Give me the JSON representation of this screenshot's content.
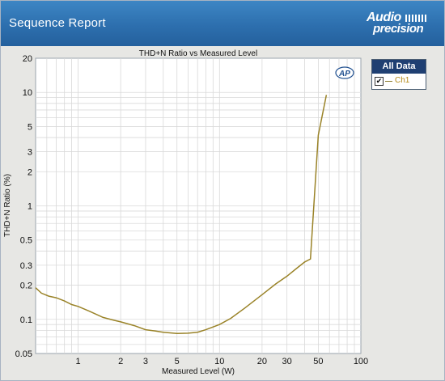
{
  "window": {
    "title": "Sequence Report",
    "brand_line1": "Audio",
    "brand_line2": "precision"
  },
  "legend": {
    "title": "All Data",
    "series_label": "Ch1",
    "checked": true
  },
  "ap_logo": "AP",
  "colors": {
    "header_bg": "#2d6fae",
    "series": "#9a8328",
    "grid": "#d9d9d9"
  },
  "chart_data": {
    "type": "line",
    "title": "THD+N Ratio vs Measured Level",
    "xlabel": "Measured Level (W)",
    "ylabel": "THD+N Ratio (%)",
    "xscale": "log",
    "yscale": "log",
    "xlim": [
      0.5,
      100
    ],
    "ylim": [
      0.05,
      20
    ],
    "xticks": [
      1,
      2,
      3,
      5,
      10,
      20,
      30,
      50,
      100
    ],
    "yticks": [
      0.05,
      0.1,
      0.2,
      0.3,
      0.5,
      1,
      2,
      3,
      5,
      10,
      20
    ],
    "grid": true,
    "legend_position": "right",
    "series": [
      {
        "name": "Ch1",
        "x": [
          0.5,
          0.55,
          0.62,
          0.7,
          0.8,
          0.9,
          1.0,
          1.2,
          1.5,
          1.8,
          2.0,
          2.5,
          3.0,
          3.5,
          4.0,
          5.0,
          6.0,
          7.0,
          8.0,
          10,
          12,
          15,
          20,
          25,
          30,
          35,
          40,
          44,
          50,
          57
        ],
        "y": [
          0.19,
          0.17,
          0.16,
          0.155,
          0.145,
          0.135,
          0.13,
          0.118,
          0.104,
          0.098,
          0.095,
          0.088,
          0.081,
          0.079,
          0.077,
          0.075,
          0.0755,
          0.077,
          0.081,
          0.09,
          0.102,
          0.125,
          0.165,
          0.205,
          0.24,
          0.28,
          0.32,
          0.34,
          4.2,
          9.5
        ]
      }
    ]
  }
}
